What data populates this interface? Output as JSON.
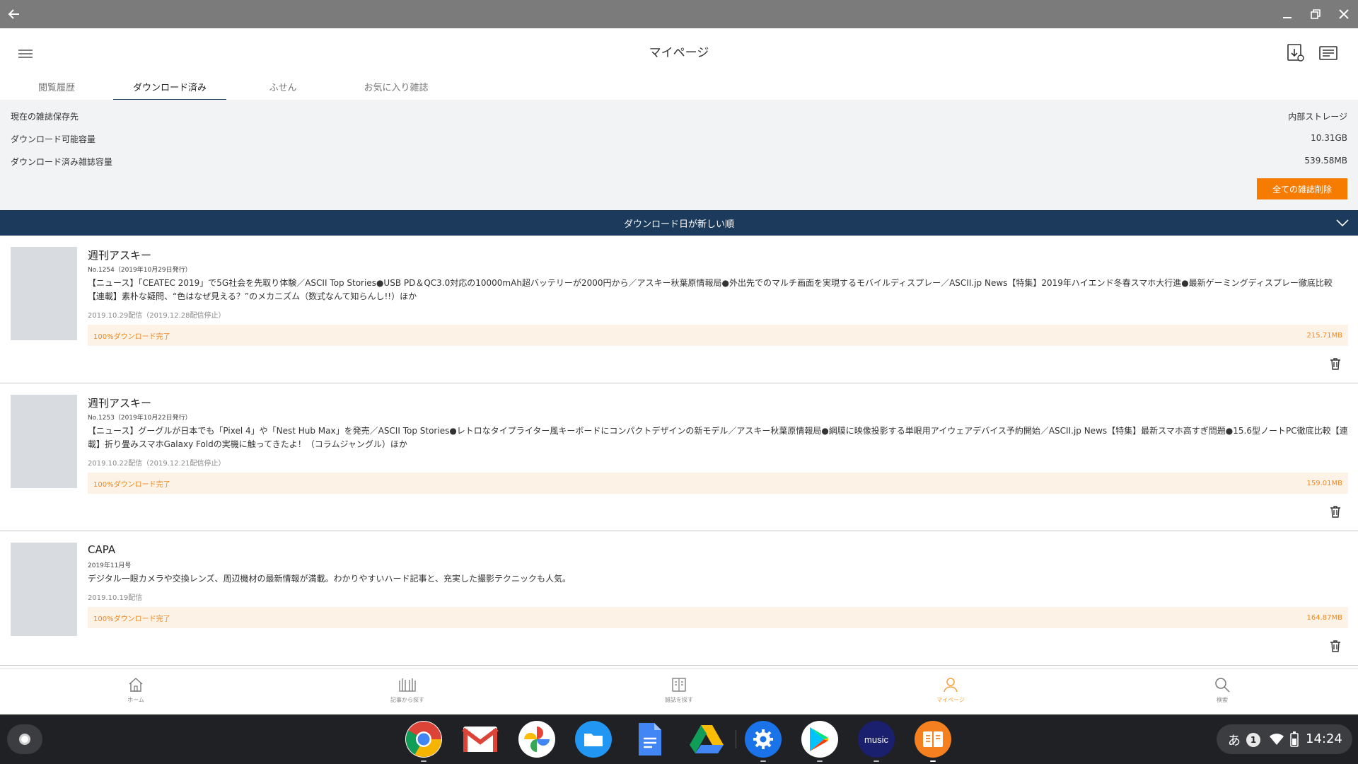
{
  "window": {
    "back_icon": "arrow-left-icon",
    "controls": [
      "minimize-icon",
      "maximize-icon",
      "close-icon"
    ]
  },
  "header": {
    "title": "マイページ",
    "menu_icon": "hamburger-menu-icon",
    "right_icons": [
      "download-manage-icon",
      "news-icon"
    ]
  },
  "tabs": [
    {
      "label": "閲覧履歴",
      "active": false
    },
    {
      "label": "ダウンロード済み",
      "active": true
    },
    {
      "label": "ふせん",
      "active": false
    },
    {
      "label": "お気に入り雑誌",
      "active": false
    }
  ],
  "storage": {
    "rows": [
      {
        "label": "現在の雑誌保存先",
        "value": "内部ストレージ"
      },
      {
        "label": "ダウンロード可能容量",
        "value": "10.31GB"
      },
      {
        "label": "ダウンロード済み雑誌容量",
        "value": "539.58MB"
      }
    ],
    "delete_all_label": "全ての雑誌削除",
    "delete_all_color": "#f57c00"
  },
  "sort": {
    "label": "ダウンロード日が新しい順",
    "bar_color": "#1b3a5c"
  },
  "items": [
    {
      "title": "週刊アスキー",
      "issue": "No.1254（2019年10月29日発行）",
      "description": "【ニュース】「CEATEC 2019」で5G社会を先取り体験／ASCII Top Stories●USB PD＆QC3.0対応の10000mAh超バッテリーが2000円から／アスキー秋葉原情報局●外出先でのマルチ画面を実現するモバイルディスプレー／ASCII.jp News【特集】2019年ハイエンド冬春スマホ大行進●最新ゲーミングディスプレー徹底比較【連載】素朴な疑問、“色はなぜ見える？”のメカニズム（数式なんて知らんし!!）ほか",
      "date": "2019.10.29配信（2019.12.28配信停止）",
      "status": "100%ダウンロード完了",
      "size": "215.71MB"
    },
    {
      "title": "週刊アスキー",
      "issue": "No.1253（2019年10月22日発行）",
      "description": "【ニュース】グーグルが日本でも「Pixel 4」や「Nest Hub Max」を発売／ASCII Top Stories●レトロなタイプライター風キーボードにコンパクトデザインの新モデル／アスキー秋葉原情報局●網膜に映像投影する単眼用アイウェアデバイス予約開始／ASCII.jp News【特集】最新スマホ高すぎ問題●15.6型ノートPC徹底比較【連載】折り畳みスマホGalaxy Foldの実機に触ってきたよ！（コラムジャングル）ほか",
      "date": "2019.10.22配信（2019.12.21配信停止）",
      "status": "100%ダウンロード完了",
      "size": "159.01MB"
    },
    {
      "title": "CAPA",
      "issue": "2019年11月号",
      "description": "デジタル一眼カメラや交換レンズ、周辺機材の最新情報が満載。わかりやすいハード記事と、充実した撮影テクニックも人気。",
      "date": "2019.10.19配信",
      "status": "100%ダウンロード完了",
      "size": "164.87MB"
    }
  ],
  "bottom_nav": [
    {
      "label": "ホーム",
      "icon": "home-icon",
      "active": false
    },
    {
      "label": "記事から探す",
      "icon": "articles-icon",
      "active": false
    },
    {
      "label": "雑誌を探す",
      "icon": "magazines-icon",
      "active": false
    },
    {
      "label": "マイページ",
      "icon": "person-icon",
      "active": true
    },
    {
      "label": "検索",
      "icon": "search-icon",
      "active": false
    }
  ],
  "shelf": {
    "apps": [
      "chrome-icon",
      "gmail-icon",
      "photos-icon",
      "files-icon",
      "docs-icon",
      "drive-icon",
      "settings-icon",
      "play-store-icon",
      "amazon-music-icon",
      "magazine-app-icon"
    ],
    "music_label": "music",
    "ime": "あ",
    "notification_count": "1",
    "time": "14:24"
  }
}
